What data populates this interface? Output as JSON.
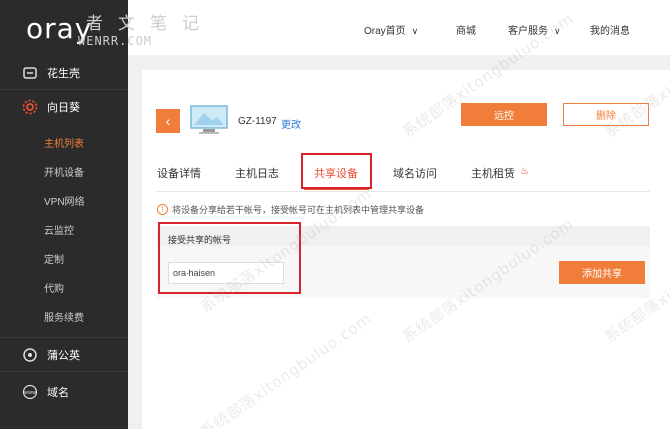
{
  "header": {
    "logo": "oray",
    "watermark_chars": "者文笔记",
    "watermark_url": "WENRR.COM",
    "nav": [
      {
        "label": "Oray首页",
        "has_menu": true
      },
      {
        "label": "商城",
        "has_menu": false
      },
      {
        "label": "客户服务",
        "has_menu": true
      },
      {
        "label": "我的消息",
        "has_menu": false
      }
    ]
  },
  "sidebar": {
    "items": [
      {
        "label": "花生壳",
        "icon": "peanut-shell-icon"
      },
      {
        "label": "向日葵",
        "icon": "sunflower-icon",
        "accent": "#e94f33"
      },
      {
        "label": "蒲公英",
        "icon": "dandelion-icon"
      },
      {
        "label": "域名",
        "icon": "www-icon"
      }
    ],
    "subitems": [
      {
        "label": "主机列表",
        "active": true
      },
      {
        "label": "开机设备"
      },
      {
        "label": "VPN网络"
      },
      {
        "label": "云监控"
      },
      {
        "label": "定制"
      },
      {
        "label": "代购"
      },
      {
        "label": "服务续费"
      }
    ]
  },
  "device": {
    "name": "GZ-1197",
    "edit_label": "更改",
    "remote_label": "远控",
    "delete_label": "删除"
  },
  "tabs": [
    {
      "label": "设备详情"
    },
    {
      "label": "主机日志"
    },
    {
      "label": "共享设备",
      "active": true
    },
    {
      "label": "域名访问"
    },
    {
      "label": "主机租赁"
    }
  ],
  "share": {
    "notice": "将设备分享给若干帐号，接受帐号可在主机列表中管理共享设备",
    "header_label": "接受共享的帐号",
    "account_value": "ora∙haisen",
    "add_button": "添加共享"
  },
  "watermark_text": "系统部落xitongbuluo.com",
  "colors": {
    "accent": "#f07e3a",
    "highlight_box": "#d9232b",
    "link": "#2a7ad8",
    "sidebar_bg": "#2b2b2b"
  }
}
